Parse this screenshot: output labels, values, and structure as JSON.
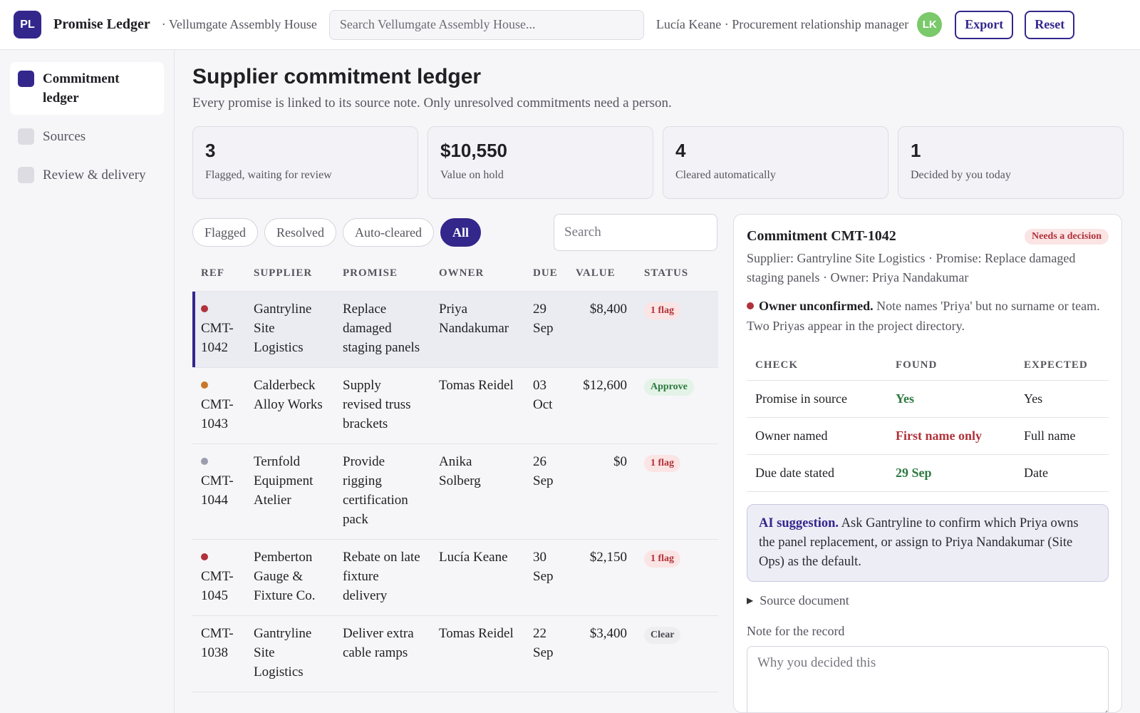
{
  "app": {
    "logo": "PL",
    "title": "Promise Ledger",
    "workspace": "· Vellumgate Assembly House",
    "search_placeholder": "Search Vellumgate Assembly House...",
    "user": "Lucía Keane · Procurement relationship manager",
    "avatar": "LK",
    "export_label": "Export",
    "reset_label": "Reset"
  },
  "sidebar": {
    "items": [
      {
        "label": "Commitment ledger",
        "active": true
      },
      {
        "label": "Sources",
        "active": false
      },
      {
        "label": "Review & delivery",
        "active": false
      }
    ]
  },
  "page": {
    "title": "Supplier commitment ledger",
    "subtitle": "Every promise is linked to its source note. Only unresolved commitments need a person."
  },
  "stats": [
    {
      "value": "3",
      "label": "Flagged, waiting for review"
    },
    {
      "value": "$10,550",
      "label": "Value on hold"
    },
    {
      "value": "4",
      "label": "Cleared automatically"
    },
    {
      "value": "1",
      "label": "Decided by you today"
    }
  ],
  "filters": {
    "chips": [
      "Flagged",
      "Resolved",
      "Auto-cleared",
      "All"
    ],
    "active": "All",
    "search_placeholder": "Search"
  },
  "table": {
    "headers": [
      "REF",
      "SUPPLIER",
      "PROMISE",
      "OWNER",
      "DUE",
      "VALUE",
      "STATUS"
    ],
    "rows": [
      {
        "ref": "CMT-1042",
        "dot": "#b0323a",
        "supplier": "Gantryline Site Logistics",
        "promise": "Replace damaged staging panels",
        "owner": "Priya Nandakumar",
        "due": "29 Sep",
        "value": "$8,400",
        "status": "1 flag",
        "status_kind": "flag",
        "selected": true
      },
      {
        "ref": "CMT-1043",
        "dot": "#c8782a",
        "supplier": "Calderbeck Alloy Works",
        "promise": "Supply revised truss brackets",
        "owner": "Tomas Reidel",
        "due": "03 Oct",
        "value": "$12,600",
        "status": "Approve",
        "status_kind": "approve",
        "selected": false
      },
      {
        "ref": "CMT-1044",
        "dot": "#9d9db0",
        "supplier": "Ternfold Equipment Atelier",
        "promise": "Provide rigging certification pack",
        "owner": "Anika Solberg",
        "due": "26 Sep",
        "value": "$0",
        "status": "1 flag",
        "status_kind": "flag",
        "selected": false
      },
      {
        "ref": "CMT-1045",
        "dot": "#b0323a",
        "supplier": "Pemberton Gauge & Fixture Co.",
        "promise": "Rebate on late fixture delivery",
        "owner": "Lucía Keane",
        "due": "30 Sep",
        "value": "$2,150",
        "status": "1 flag",
        "status_kind": "flag",
        "selected": false
      },
      {
        "ref": "CMT-1038",
        "dot": "",
        "supplier": "Gantryline Site Logistics",
        "promise": "Deliver extra cable ramps",
        "owner": "Tomas Reidel",
        "due": "22 Sep",
        "value": "$3,400",
        "status": "Clear",
        "status_kind": "clear",
        "selected": false
      }
    ]
  },
  "detail": {
    "title": "Commitment CMT-1042",
    "badge": "Needs a decision",
    "meta": "Supplier: Gantryline Site Logistics · Promise: Replace damaged staging panels · Owner: Priya Nandakumar",
    "issue_title": "Owner unconfirmed.",
    "issue_text": " Note names 'Priya' but no surname or team. Two Priyas appear in the project directory.",
    "checks_headers": [
      "CHECK",
      "FOUND",
      "EXPECTED"
    ],
    "checks": [
      {
        "check": "Promise in source",
        "found": "Yes",
        "found_ok": true,
        "expected": "Yes"
      },
      {
        "check": "Owner named",
        "found": "First name only",
        "found_ok": false,
        "expected": "Full name"
      },
      {
        "check": "Due date stated",
        "found": "29 Sep",
        "found_ok": true,
        "expected": "Date"
      }
    ],
    "ai_label": "AI suggestion.",
    "ai_text": " Ask Gantryline to confirm which Priya owns the panel replacement, or assign to Priya Nandakumar (Site Ops) as the default.",
    "source_label": "Source document",
    "note_label": "Note for the record",
    "note_placeholder": "Why you decided this"
  }
}
